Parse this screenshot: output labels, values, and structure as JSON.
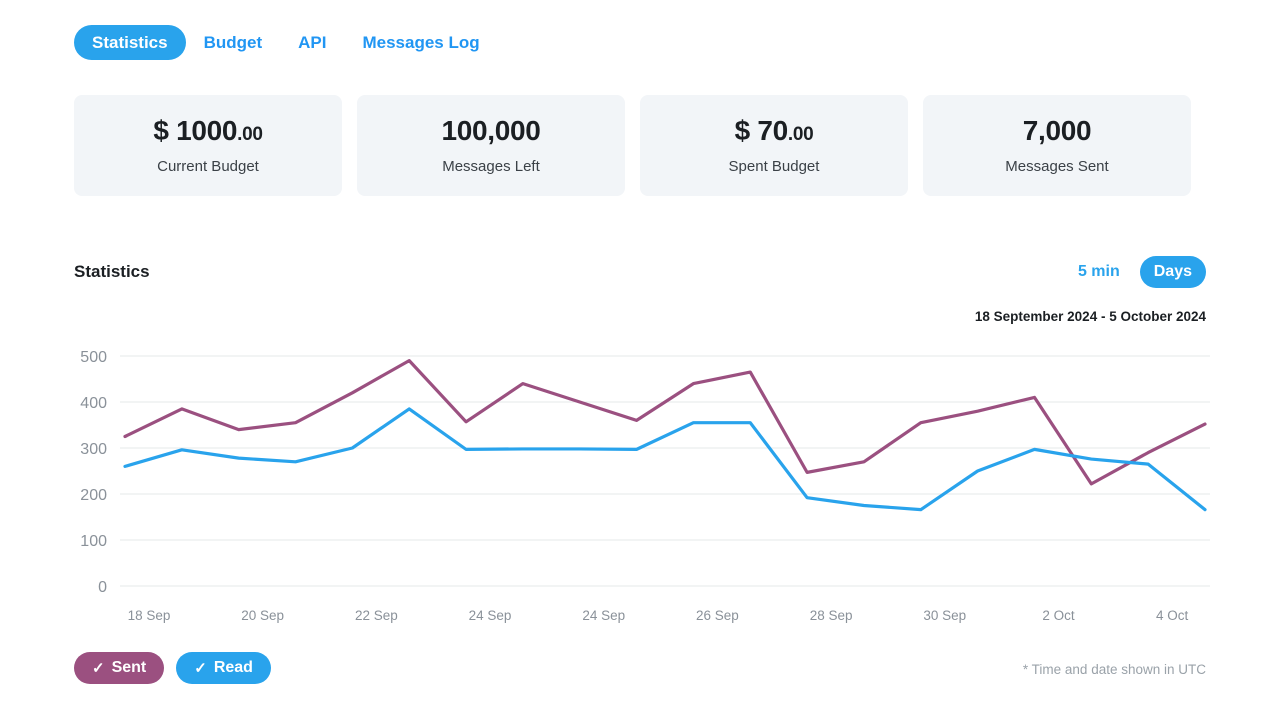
{
  "tabs": [
    {
      "label": "Statistics",
      "active": true
    },
    {
      "label": "Budget",
      "active": false
    },
    {
      "label": "API",
      "active": false
    },
    {
      "label": "Messages Log",
      "active": false
    }
  ],
  "cards": [
    {
      "value": "$ 1000",
      "cents": ".00",
      "label": "Current Budget"
    },
    {
      "value": "100,000",
      "cents": "",
      "label": "Messages Left"
    },
    {
      "value": "$ 70",
      "cents": ".00",
      "label": "Spent Budget"
    },
    {
      "value": "7,000",
      "cents": "",
      "label": "Messages Sent"
    }
  ],
  "chart_section": {
    "title": "Statistics",
    "range_options": [
      {
        "label": "5 min",
        "active": false
      },
      {
        "label": "Days",
        "active": true
      }
    ],
    "date_range": "18 September 2024 - 5 October 2024",
    "legend": [
      {
        "label": "Sent",
        "tick": "✓",
        "color": "#9b5080"
      },
      {
        "label": "Read",
        "tick": "✓",
        "color": "#29a3ec"
      }
    ],
    "footnote": "*  Time and date shown in UTC"
  },
  "chart_data": {
    "type": "line",
    "title": "Statistics",
    "xlabel": "",
    "ylabel": "",
    "ylim": [
      0,
      500
    ],
    "yticks": [
      0,
      100,
      200,
      300,
      400,
      500
    ],
    "grid": true,
    "legend_position": "bottom-left",
    "x": [
      "18 Sep",
      "19 Sep",
      "20 Sep",
      "21 Sep",
      "22 Sep",
      "23 Sep",
      "24 Sep",
      "25 Sep",
      "24 Sep",
      "25 Sep",
      "26 Sep",
      "27 Sep",
      "28 Sep",
      "29 Sep",
      "30 Sep",
      "1 Oct",
      "2 Oct",
      "3 Oct",
      "4 Oct",
      "5 Oct"
    ],
    "xtick_labels": [
      "18 Sep",
      "20 Sep",
      "22 Sep",
      "24 Sep",
      "24 Sep",
      "26 Sep",
      "28 Sep",
      "30 Sep",
      "2 Oct",
      "4 Oct"
    ],
    "series": [
      {
        "name": "Sent",
        "color": "#9b5080",
        "values": [
          325,
          385,
          340,
          355,
          420,
          490,
          357,
          440,
          400,
          360,
          440,
          465,
          247,
          270,
          355,
          380,
          410,
          222,
          290,
          352
        ]
      },
      {
        "name": "Read",
        "color": "#29a3ec",
        "values": [
          260,
          296,
          278,
          270,
          300,
          385,
          297,
          298,
          298,
          297,
          355,
          355,
          192,
          175,
          166,
          250,
          297,
          276,
          265,
          166
        ]
      }
    ]
  }
}
